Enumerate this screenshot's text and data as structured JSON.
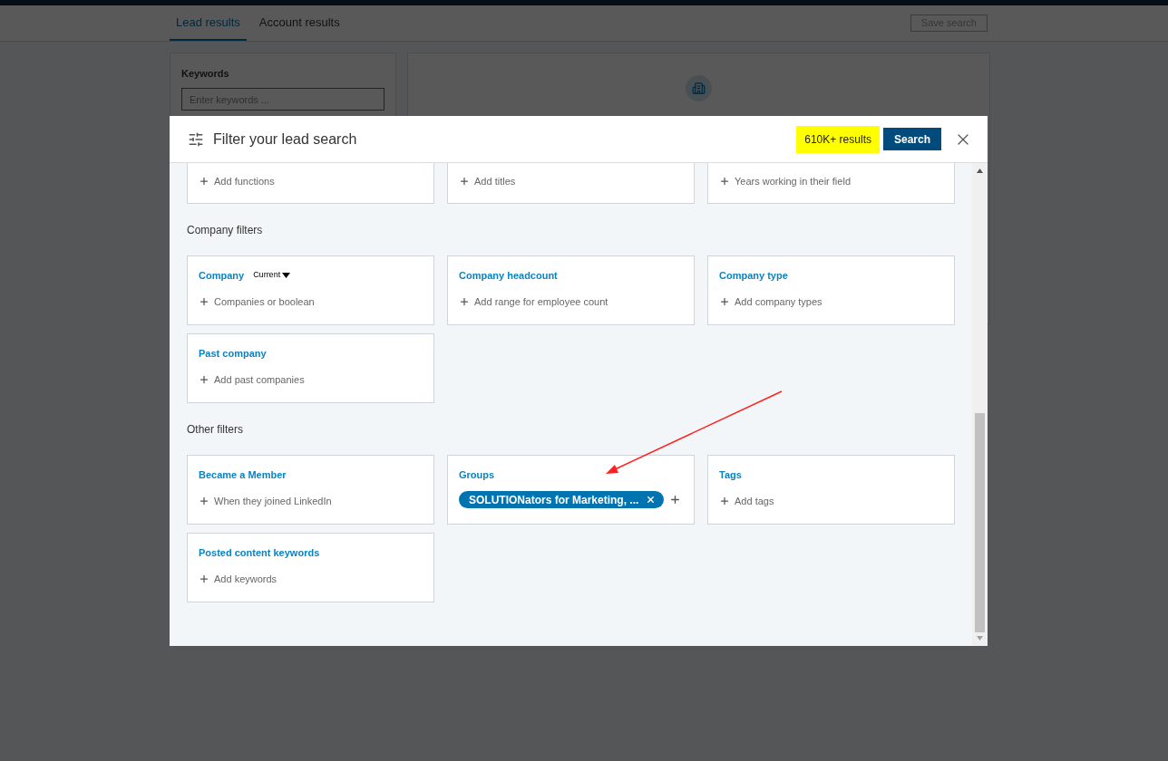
{
  "page": {
    "tabs": [
      {
        "label": "Lead results",
        "selected": true
      },
      {
        "label": "Account results",
        "selected": false
      }
    ],
    "save_button": "Save search",
    "keywords": {
      "label": "Keywords",
      "placeholder": "Enter keywords ..."
    }
  },
  "modal": {
    "title": "Filter your lead search",
    "results": "610K+ results",
    "search_button": "Search",
    "top_row": [
      {
        "add": "Add functions"
      },
      {
        "add": "Add titles"
      },
      {
        "add": "Years working in their field"
      }
    ],
    "sections": [
      {
        "title": "Company filters",
        "filters": [
          {
            "label": "Company",
            "dropdown": "Current",
            "add": "Companies or boolean"
          },
          {
            "label": "Company headcount",
            "add": "Add range for employee count"
          },
          {
            "label": "Company type",
            "add": "Add company types"
          },
          {
            "label": "Past company",
            "add": "Add past companies"
          }
        ]
      },
      {
        "title": "Other filters",
        "filters": [
          {
            "label": "Became a Member",
            "add": "When they joined LinkedIn"
          },
          {
            "label": "Groups",
            "chips": [
              "SOLUTIONators for Marketing, ..."
            ]
          },
          {
            "label": "Tags",
            "add": "Add tags"
          },
          {
            "label": "Posted content keywords",
            "add": "Add keywords"
          }
        ]
      }
    ]
  }
}
